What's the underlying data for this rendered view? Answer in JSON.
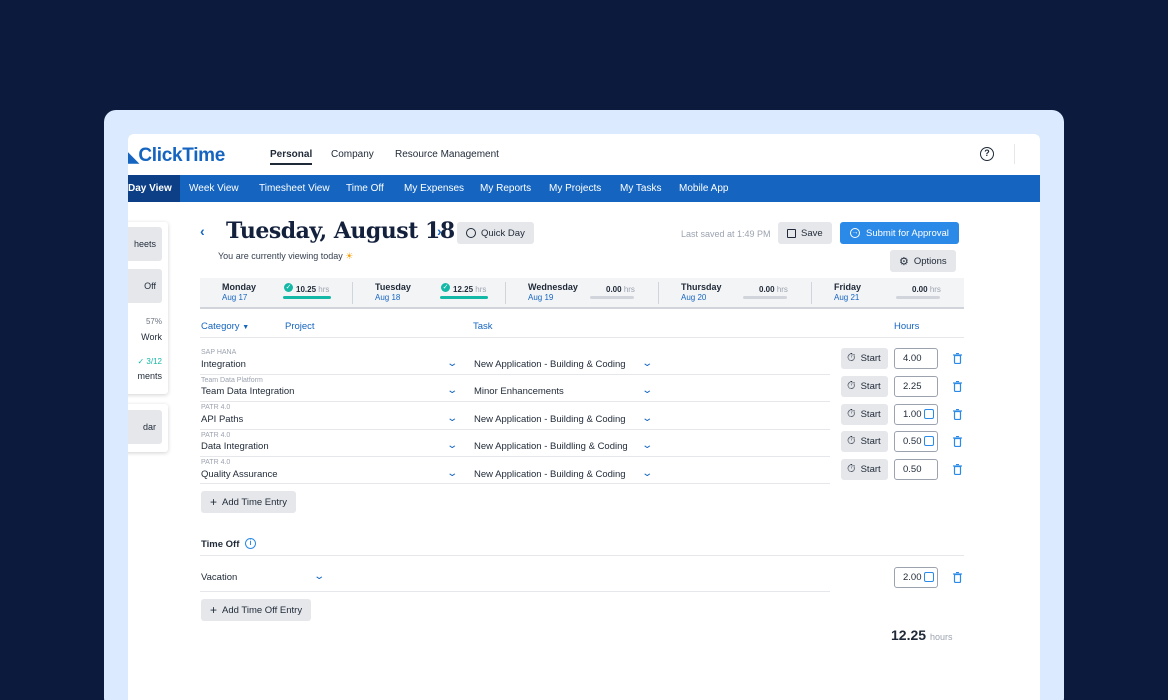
{
  "header": {
    "logo": "ClickTime",
    "tabs": [
      "Personal",
      "Company",
      "Resource Management"
    ],
    "active_tab": "Personal"
  },
  "nav": {
    "items": [
      "Day View",
      "Week View",
      "Timesheet View",
      "Time Off",
      "My Expenses",
      "My Reports",
      "My Projects",
      "My Tasks",
      "Mobile App"
    ],
    "active": "Day View"
  },
  "sidebar": {
    "card1": {
      "btn1": "heets",
      "btn2": "Off",
      "pct": "57%",
      "work": "Work",
      "count": "✓ 3/12",
      "ments": "ments"
    },
    "card2": {
      "btn": "dar"
    }
  },
  "day_header": {
    "title": "Tuesday, August 18",
    "subtitle": "You are currently viewing today",
    "quick_day": "Quick Day",
    "last_saved": "Last saved at 1:49 PM",
    "save": "Save",
    "submit": "Submit for Approval",
    "options": "Options"
  },
  "days": [
    {
      "name": "Monday",
      "date": "Aug 17",
      "hours": "10.25",
      "unit": "hrs",
      "complete": true,
      "fill": 1.0
    },
    {
      "name": "Tuesday",
      "date": "Aug 18",
      "hours": "12.25",
      "unit": "hrs",
      "complete": true,
      "fill": 1.0
    },
    {
      "name": "Wednesday",
      "date": "Aug 19",
      "hours": "0.00",
      "unit": "hrs",
      "complete": false,
      "fill": 0
    },
    {
      "name": "Thursday",
      "date": "Aug 20",
      "hours": "0.00",
      "unit": "hrs",
      "complete": false,
      "fill": 0
    },
    {
      "name": "Friday",
      "date": "Aug 21",
      "hours": "0.00",
      "unit": "hrs",
      "complete": false,
      "fill": 0
    }
  ],
  "table": {
    "headers": {
      "category": "Category",
      "project": "Project",
      "task": "Task",
      "hours": "Hours"
    },
    "rows": [
      {
        "client": "SAP HANA",
        "project": "Integration",
        "task": "New Application - Building & Coding",
        "hours": "4.00",
        "note": false
      },
      {
        "client": "Team Data Platform",
        "project": "Team Data Integration",
        "task": "Minor Enhancements",
        "hours": "2.25",
        "note": false
      },
      {
        "client": "PATR 4.0",
        "project": "API Paths",
        "task": "New Application - Building & Coding",
        "hours": "1.00",
        "note": true
      },
      {
        "client": "PATR 4.0",
        "project": "Data Integration",
        "task": "New Application - Buildling & Coding",
        "hours": "0.50",
        "note": true
      },
      {
        "client": "PATR 4.0",
        "project": "Quality Assurance",
        "task": "New Application - Building & Coding",
        "hours": "0.50",
        "note": false
      }
    ],
    "start_label": "Start",
    "add_entry": "Add Time Entry"
  },
  "time_off": {
    "title": "Time Off",
    "type": "Vacation",
    "hours": "2.00",
    "add_entry": "Add Time Off Entry"
  },
  "total": {
    "value": "12.25",
    "unit": "hours"
  },
  "colors": {
    "brand": "#1565c0",
    "accent": "#2b8ae8",
    "progress": "#14b8a6",
    "background": "#0b1a3d"
  }
}
